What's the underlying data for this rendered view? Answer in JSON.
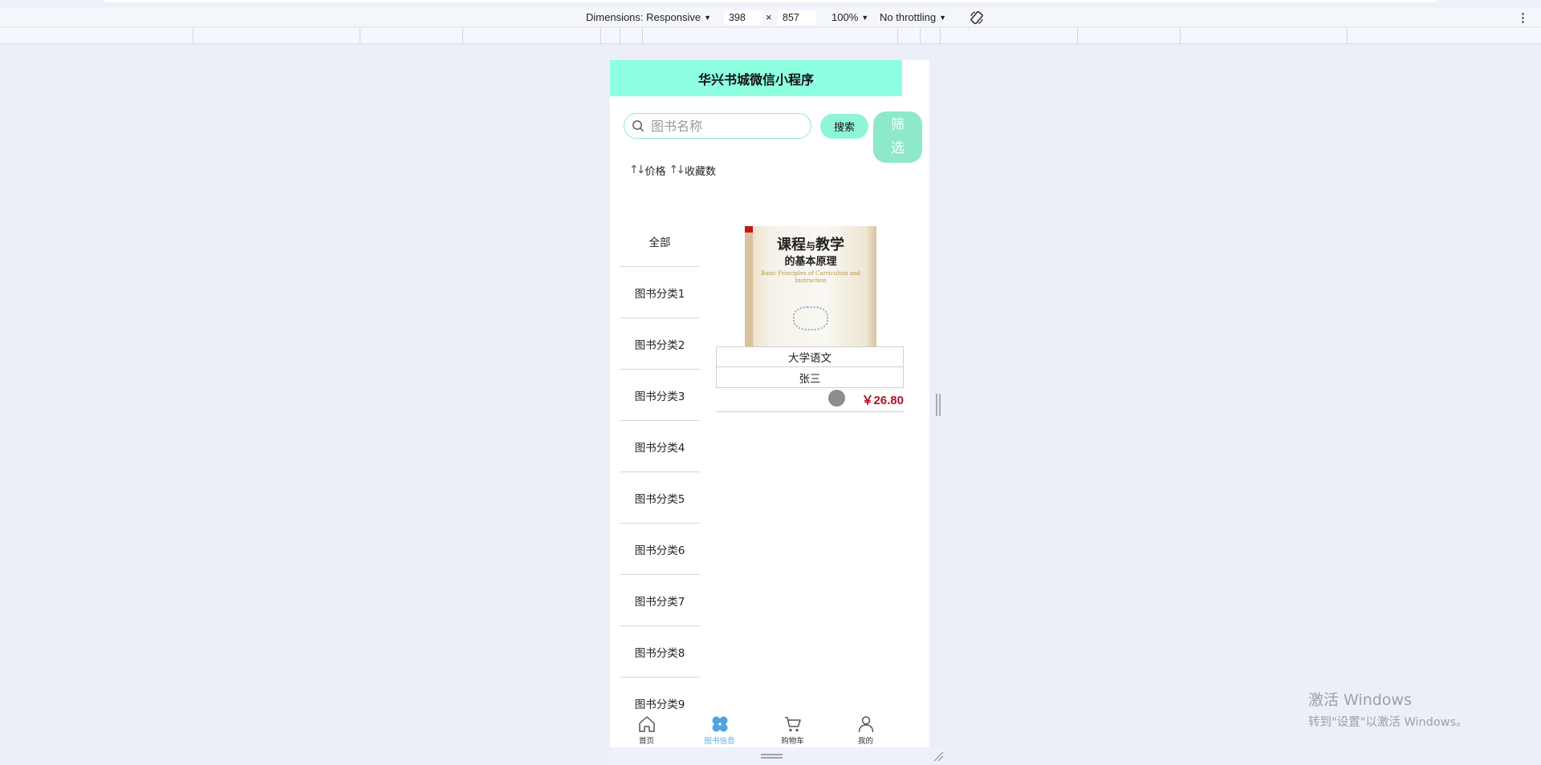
{
  "devtools": {
    "dimensions_label": "Dimensions: Responsive",
    "width_value": "398",
    "times": "×",
    "height_value": "857",
    "zoom": "100%",
    "throttling": "No throttling"
  },
  "app": {
    "title": "华兴书城微信小程序",
    "search": {
      "placeholder": "图书名称",
      "button_label": "搜索"
    },
    "filter": {
      "char1": "筛",
      "char2": "选"
    },
    "sort": {
      "price_label": "价格",
      "favorites_label": "收藏数"
    },
    "categories": [
      "全部",
      "图书分类1",
      "图书分类2",
      "图书分类3",
      "图书分类4",
      "图书分类5",
      "图书分类6",
      "图书分类7",
      "图书分类8",
      "图书分类9"
    ],
    "book": {
      "cover_title_part1": "课程",
      "cover_title_small": "与",
      "cover_title_part2": "教学",
      "cover_subtitle": "的基本原理",
      "cover_english": "Basic Principles of Curriculum and Instruction",
      "name": "大学语文",
      "author": "张三",
      "price": "￥26.80"
    },
    "tabbar": [
      {
        "label": "首页",
        "icon": "home-icon",
        "active": false
      },
      {
        "label": "图书信息",
        "icon": "grid-clover-icon",
        "active": true
      },
      {
        "label": "购物车",
        "icon": "cart-icon",
        "active": false
      },
      {
        "label": "我的",
        "icon": "user-icon",
        "active": false
      }
    ],
    "colors": {
      "header_bg": "#8effe0",
      "accent": "#8ef5d9",
      "price": "#b0122a",
      "active_tab": "#5aaee0"
    }
  },
  "watermark": {
    "title": "激活 Windows",
    "subtitle": "转到\"设置\"以激活 Windows。"
  }
}
